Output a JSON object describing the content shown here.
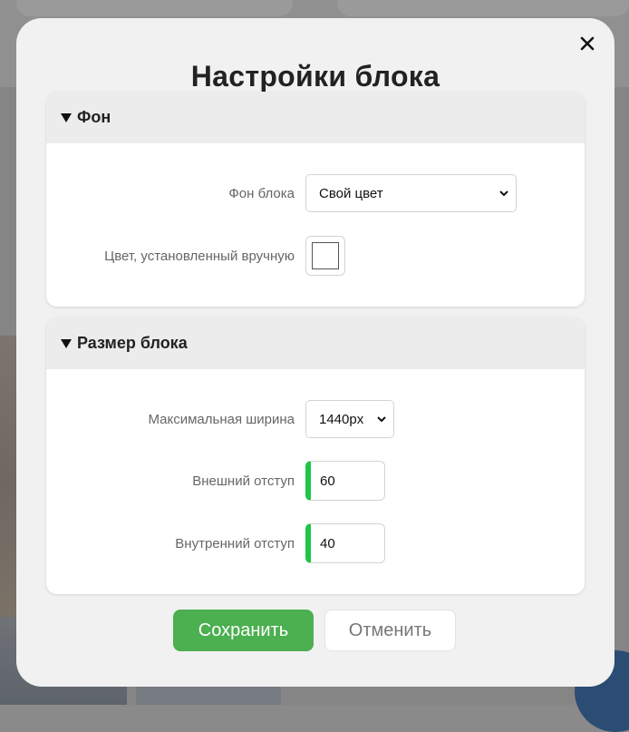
{
  "modal": {
    "title": "Настройки блока",
    "close_icon": "close-icon"
  },
  "sections": {
    "background": {
      "title": "Фон",
      "block_bg_label": "Фон блока",
      "block_bg_value": "Свой цвет",
      "custom_color_label": "Цвет, установленный вручную",
      "custom_color_value": "#ffffff"
    },
    "size": {
      "title": "Размер блока",
      "max_width_label": "Максимальная ширина",
      "max_width_value": "1440px",
      "outer_padding_label": "Внешний отступ",
      "outer_padding_value": "60",
      "inner_padding_label": "Внутренний отступ",
      "inner_padding_value": "40"
    }
  },
  "actions": {
    "save_label": "Сохранить",
    "cancel_label": "Отменить"
  },
  "colors": {
    "save_button": "#4caf50",
    "input_accent": "#1fc44a"
  }
}
